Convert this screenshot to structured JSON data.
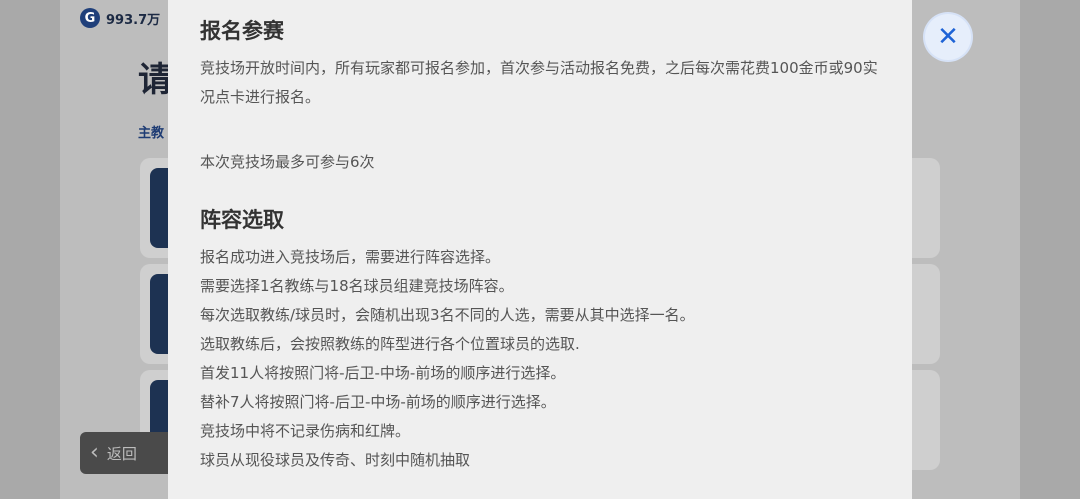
{
  "background": {
    "currency_amount": "993.7万",
    "currency_icon": "G",
    "title_partial": "请",
    "subtitle_partial": "主教",
    "back_label": "返回"
  },
  "modal": {
    "sections": [
      {
        "title": "报名参赛",
        "paragraphs": [
          "竞技场开放时间内，所有玩家都可报名参加，首次参与活动报名免费，之后每次需花费100金币或90实况点卡进行报名。"
        ],
        "extra": "本次竞技场最多可参与6次"
      },
      {
        "title": "阵容选取",
        "lines": [
          "报名成功进入竞技场后，需要进行阵容选择。",
          "需要选择1名教练与18名球员组建竞技场阵容。",
          "每次选取教练/球员时，会随机出现3名不同的人选，需要从其中选择一名。",
          "选取教练后，会按照教练的阵型进行各个位置球员的选取.",
          "首发11人将按照门将-后卫-中场-前场的顺序进行选择。",
          "替补7人将按照门将-后卫-中场-前场的顺序进行选择。",
          "竞技场中将不记录伤病和红牌。",
          "球员从现役球员及传奇、时刻中随机抽取"
        ]
      }
    ]
  },
  "colors": {
    "accent": "#1e63d6",
    "modal_bg": "#efefef"
  }
}
